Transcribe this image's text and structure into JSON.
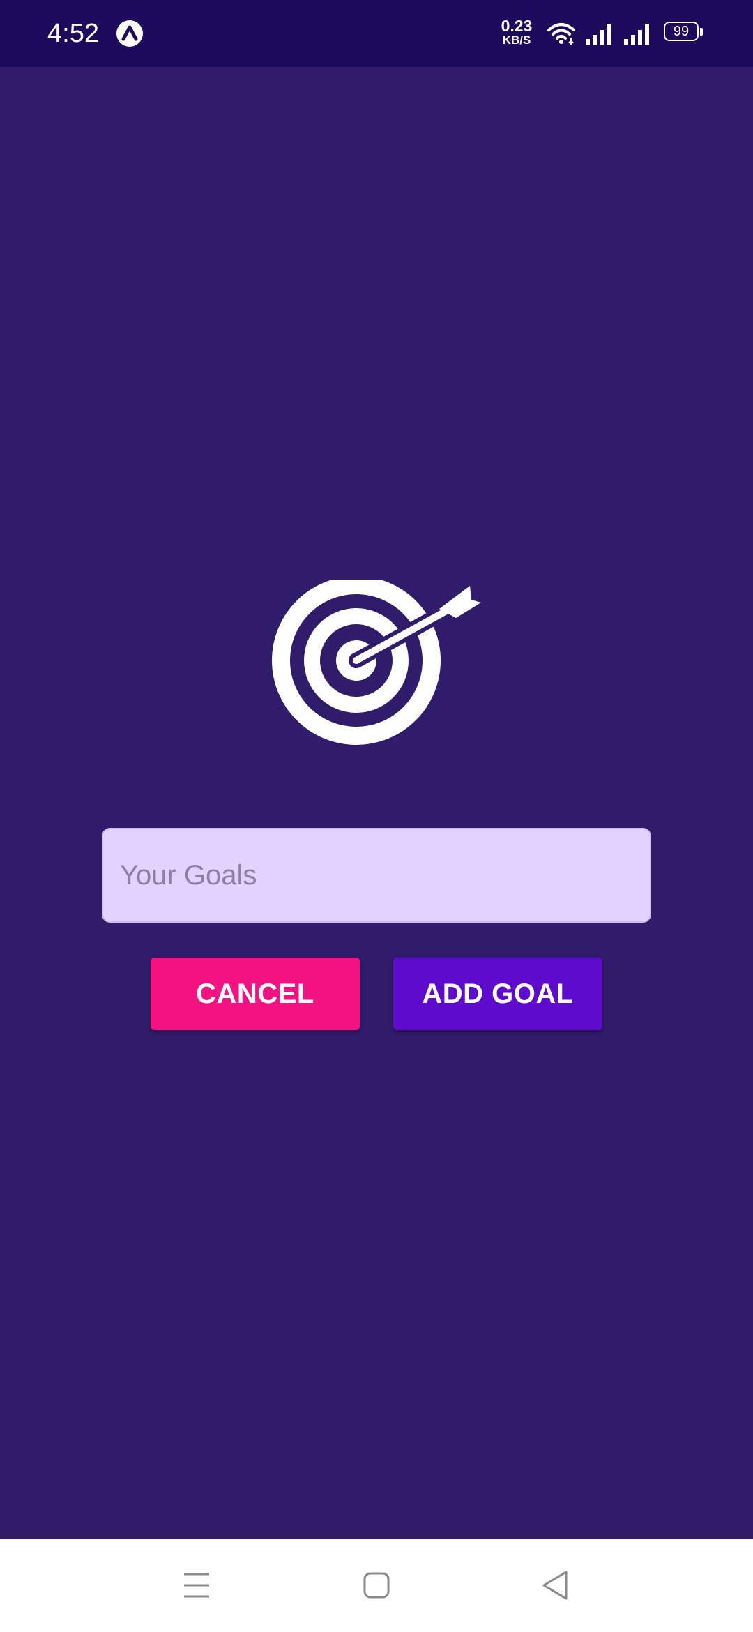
{
  "status_bar": {
    "time": "4:52",
    "net_speed_value": "0.23",
    "net_speed_unit": "KB/S",
    "battery_level": "99",
    "icons": [
      "app-indicator-icon",
      "wifi-icon",
      "signal-icon",
      "signal-icon",
      "battery-icon"
    ]
  },
  "main": {
    "icon": "target-arrow-icon",
    "goal_input": {
      "placeholder": "Your Goals",
      "value": ""
    },
    "buttons": {
      "cancel_label": "CANCEL",
      "add_label": "ADD GOAL"
    }
  },
  "nav_bar": {
    "icons": [
      "menu-icon",
      "home-icon",
      "back-icon"
    ]
  },
  "colors": {
    "background": "#311b6b",
    "status_bar": "#1e0a5c",
    "input_background": "#e3d2fd",
    "cancel_button": "#f31282",
    "add_button": "#5e0acc",
    "nav_bar": "#ffffff"
  }
}
